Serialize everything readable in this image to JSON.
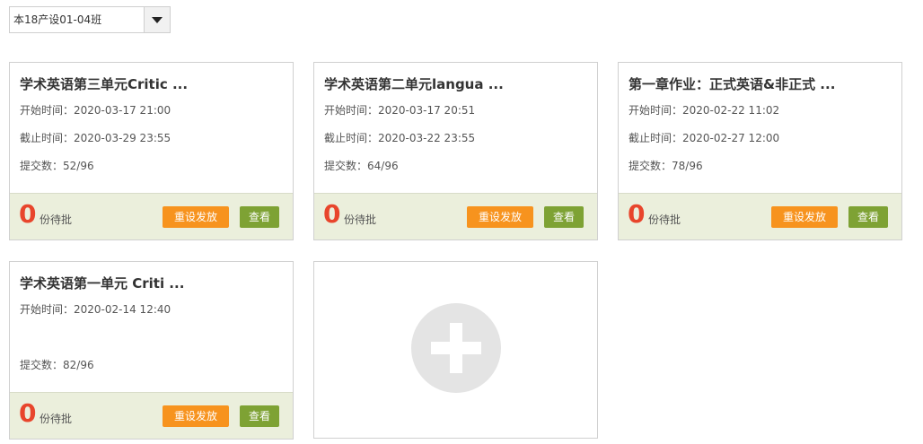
{
  "class_selector": {
    "value": "本18产设01-04班"
  },
  "assignments": [
    {
      "title": "学术英语第三单元Critic ...",
      "start": "开始时间：2020-03-17 21:00",
      "deadline": "截止时间：2020-03-29 23:55",
      "submitted": "提交数：52/96",
      "pending_count": "0",
      "pending_label": "份待批",
      "reset_label": "重设发放",
      "view_label": "查看"
    },
    {
      "title": "学术英语第二单元langua ...",
      "start": "开始时间：2020-03-17 20:51",
      "deadline": "截止时间：2020-03-22 23:55",
      "submitted": "提交数：64/96",
      "pending_count": "0",
      "pending_label": "份待批",
      "reset_label": "重设发放",
      "view_label": "查看"
    },
    {
      "title": "第一章作业：正式英语&非正式 ...",
      "start": "开始时间：2020-02-22 11:02",
      "deadline": "截止时间：2020-02-27 12:00",
      "submitted": "提交数：78/96",
      "pending_count": "0",
      "pending_label": "份待批",
      "reset_label": "重设发放",
      "view_label": "查看"
    },
    {
      "title": "学术英语第一单元 Criti ...",
      "start": "开始时间：2020-02-14 12:40",
      "deadline": "",
      "submitted": "提交数：82/96",
      "pending_count": "0",
      "pending_label": "份待批",
      "reset_label": "重设发放",
      "view_label": "查看"
    }
  ],
  "add_card": {
    "icon": "plus-icon"
  }
}
